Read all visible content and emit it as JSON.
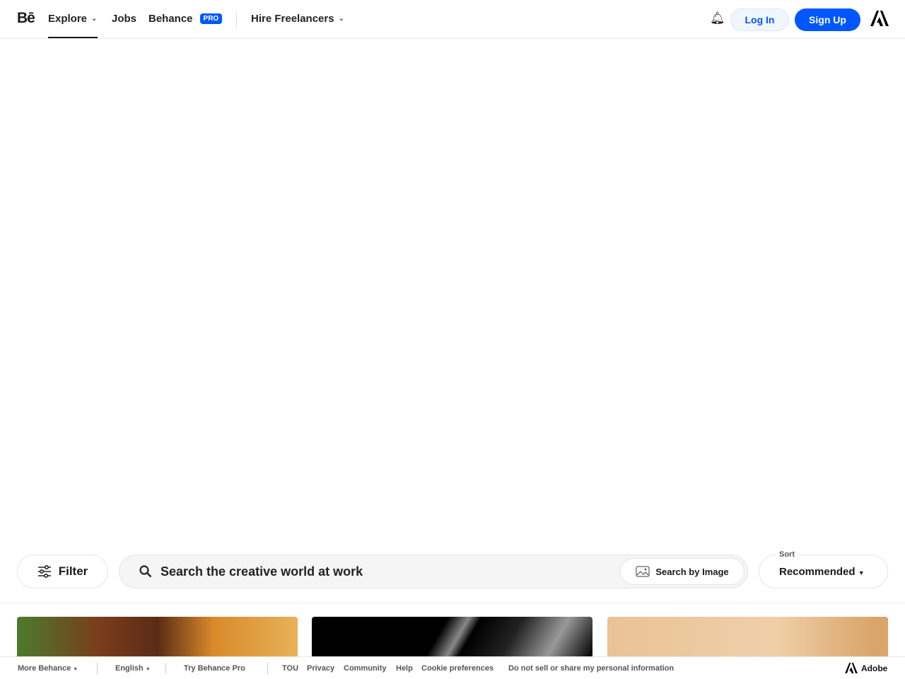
{
  "nav": {
    "logo": "Bē",
    "explore": "Explore",
    "jobs": "Jobs",
    "behance": "Behance",
    "pro": "PRO",
    "hire": "Hire Freelancers",
    "login": "Log In",
    "signup": "Sign Up"
  },
  "toolbar": {
    "filter": "Filter",
    "search_placeholder": "Search the creative world at work",
    "search_by_image": "Search by Image",
    "sort_label": "Sort",
    "sort_value": "Recommended"
  },
  "footer": {
    "more": "More Behance",
    "language": "English",
    "try_pro": "Try Behance Pro",
    "links": [
      "TOU",
      "Privacy",
      "Community",
      "Help",
      "Cookie preferences",
      "Do not sell or share my personal information"
    ],
    "adobe": "Adobe"
  }
}
